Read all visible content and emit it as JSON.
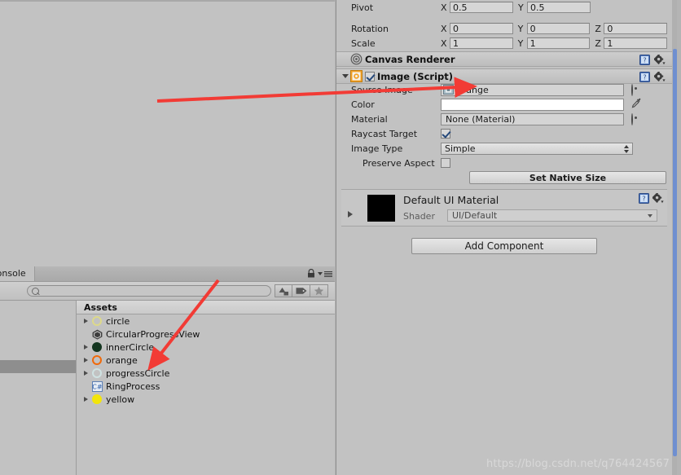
{
  "inspector": {
    "transform_rows": [
      {
        "label": "Pivot",
        "fields": [
          {
            "axis": "X",
            "value": "0.5"
          },
          {
            "axis": "Y",
            "value": "0.5"
          }
        ]
      },
      {
        "label": "Rotation",
        "fields": [
          {
            "axis": "X",
            "value": "0"
          },
          {
            "axis": "Y",
            "value": "0"
          },
          {
            "axis": "Z",
            "value": "0"
          }
        ]
      },
      {
        "label": "Scale",
        "fields": [
          {
            "axis": "X",
            "value": "1"
          },
          {
            "axis": "Y",
            "value": "1"
          },
          {
            "axis": "Z",
            "value": "1"
          }
        ]
      }
    ],
    "canvas_renderer": {
      "title": "Canvas Renderer",
      "icon": "canvas-renderer-icon",
      "help_icon": "help-icon",
      "gear_icon": "gear-icon"
    },
    "image_script": {
      "title": "Image (Script)",
      "icon": "sprite-script-icon",
      "enabled": true,
      "foldout_open": true,
      "help_icon": "help-icon",
      "gear_icon": "gear-icon",
      "source_image": {
        "label": "Source Image",
        "value": "orange",
        "icon": "sprite-icon",
        "picker": "object-picker-icon"
      },
      "color": {
        "label": "Color",
        "value": "",
        "swatch": "#ffffff",
        "picker": "eyedropper-icon"
      },
      "material": {
        "label": "Material",
        "value": "None (Material)",
        "picker": "object-picker-icon"
      },
      "raycast_target": {
        "label": "Raycast Target",
        "checked": true
      },
      "image_type": {
        "label": "Image Type",
        "value": "Simple"
      },
      "preserve_aspect": {
        "label": "Preserve Aspect",
        "checked": false
      },
      "set_native_size_button": "Set Native Size"
    },
    "material_block": {
      "title": "Default UI Material",
      "preview_color": "#000000",
      "shader_label": "Shader",
      "shader_value": "UI/Default",
      "help_icon": "help-icon",
      "gear_icon": "gear-icon"
    },
    "add_component_button": "Add Component"
  },
  "project_window": {
    "tab_label": "Console",
    "lock_icon": "lock-icon",
    "menu_icon": "hamburger-menu-icon",
    "search": {
      "placeholder": "",
      "value": "",
      "icon": "search-icon"
    },
    "filter_buttons": [
      {
        "name": "filter-by-type-button",
        "icon": "object-type-filter-icon"
      },
      {
        "name": "filter-by-label-button",
        "icon": "label-tag-icon"
      },
      {
        "name": "favorites-button",
        "icon": "star-icon"
      }
    ],
    "assets_header": "Assets",
    "assets": [
      {
        "name": "circle",
        "icon": "sprite-ring-icon",
        "color": "#e8e8a8",
        "style": "ring",
        "expandable": true
      },
      {
        "name": "CircularProgressView",
        "icon": "unity-prefab-icon",
        "color": "#4a4a4a",
        "style": "unity",
        "expandable": false
      },
      {
        "name": "innerCircle",
        "icon": "sprite-disc-icon",
        "color": "#13351f",
        "style": "disc",
        "expandable": true
      },
      {
        "name": "orange",
        "icon": "sprite-ring-icon",
        "color": "#f06a0a",
        "style": "ring",
        "expandable": true
      },
      {
        "name": "progressCircle",
        "icon": "sprite-ring-icon",
        "color": "#cfe2e2",
        "style": "ring",
        "expandable": true
      },
      {
        "name": "RingProcess",
        "icon": "csharp-script-icon",
        "color": "#4b7fc4",
        "style": "script",
        "expandable": false
      },
      {
        "name": "yellow",
        "icon": "sprite-disc-icon",
        "color": "#f2e50b",
        "style": "disc",
        "expandable": true
      }
    ]
  },
  "annotations": {
    "arrow_color": "#f23b35",
    "arrow_top_label": "arrow-to-source-image",
    "arrow_bottom_label": "arrow-to-orange-asset"
  },
  "watermark": "https://blog.csdn.net/q764424567"
}
